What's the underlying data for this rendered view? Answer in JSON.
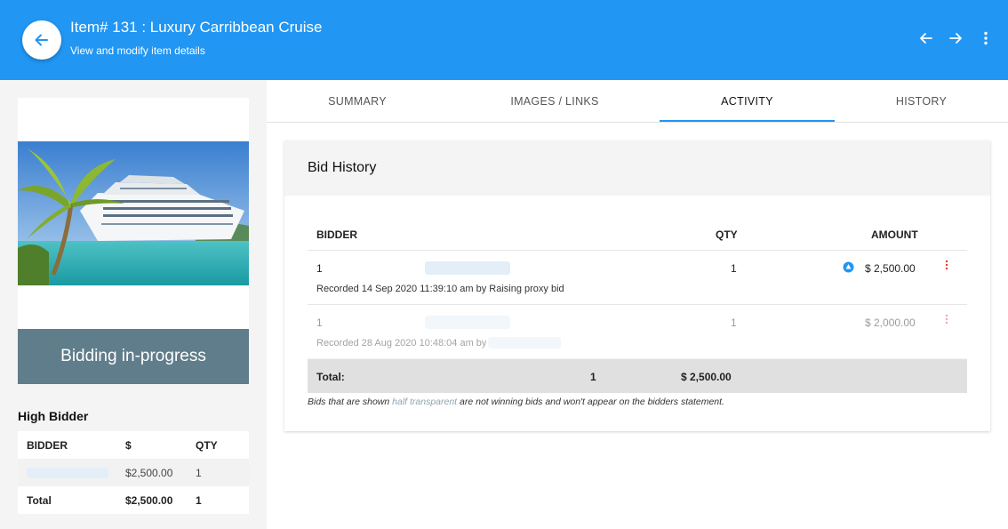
{
  "header": {
    "title": "Item# 131 : Luxury Carribbean Cruise",
    "subtitle": "View and modify item details"
  },
  "left": {
    "status": "Bidding in-progress",
    "high_bidder_title": "High Bidder",
    "table": {
      "headers": [
        "BIDDER",
        "$",
        "QTY"
      ],
      "row": {
        "amount": "$2,500.00",
        "qty": "1"
      },
      "total": {
        "label": "Total",
        "amount": "$2,500.00",
        "qty": "1"
      }
    }
  },
  "tabs": [
    "SUMMARY",
    "IMAGES / LINKS",
    "ACTIVITY",
    "HISTORY"
  ],
  "active_tab": "ACTIVITY",
  "bid_history": {
    "title": "Bid History",
    "headers": {
      "bidder": "BIDDER",
      "qty": "QTY",
      "amount": "AMOUNT"
    },
    "rows": [
      {
        "bidder": "1",
        "qty": "1",
        "amount": "$ 2,500.00",
        "recorded": "Recorded 14 Sep 2020 11:39:10 am by Raising proxy bid"
      },
      {
        "bidder": "1",
        "qty": "1",
        "amount": "$ 2,000.00",
        "recorded": "Recorded 28 Aug 2020 10:48:04 am by"
      }
    ],
    "total": {
      "label": "Total:",
      "qty": "1",
      "amount": "$ 2,500.00"
    },
    "note": {
      "before": "Bids that are shown ",
      "highlight": "half transparent",
      "after": " are not winning bids and won't appear on the bidders statement."
    }
  },
  "colors": {
    "primary": "#2196f3",
    "status_banner": "#607d8b",
    "kebab": "#e53935"
  },
  "icons": [
    "arrow-left-icon",
    "arrow-right-icon",
    "more-vert-icon",
    "proxy-bid-icon",
    "kebab-icon"
  ]
}
